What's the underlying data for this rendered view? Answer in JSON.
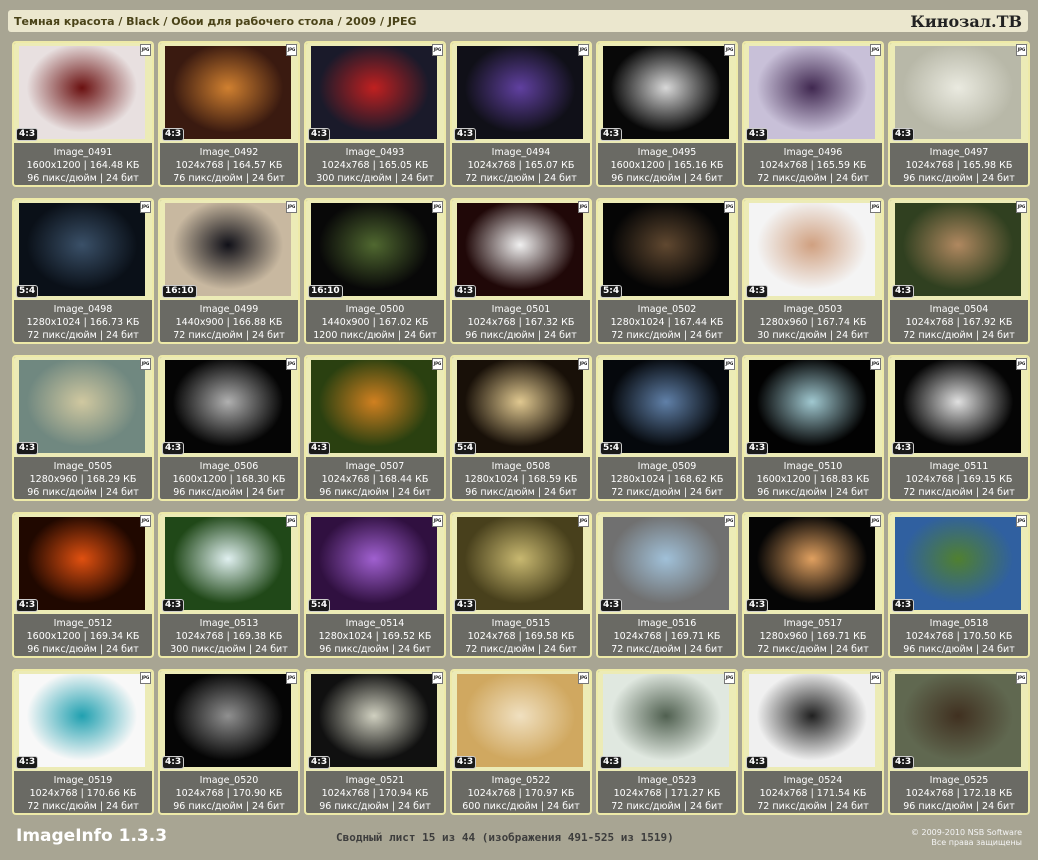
{
  "header": {
    "breadcrumb": "Темная красота / Black / Обои для рабочего стола / 2009 / JPEG",
    "brand": "Кинозал.ТВ"
  },
  "icon": "jpg-file-icon",
  "images": [
    {
      "name": "Image_0491",
      "ratio": "4:3",
      "dims": "1600x1200 | 164.48 КБ",
      "meta": "96 пикс/дюйм | 24 бит",
      "bg": "#e8e0e0",
      "accent": "#6a1010"
    },
    {
      "name": "Image_0492",
      "ratio": "4:3",
      "dims": "1024x768 | 164.57 КБ",
      "meta": "76 пикс/дюйм | 24 бит",
      "bg": "#3a1a10",
      "accent": "#d08030"
    },
    {
      "name": "Image_0493",
      "ratio": "4:3",
      "dims": "1024x768 | 165.05 КБ",
      "meta": "300 пикс/дюйм | 24 бит",
      "bg": "#1a1a2a",
      "accent": "#c02020"
    },
    {
      "name": "Image_0494",
      "ratio": "4:3",
      "dims": "1024x768 | 165.07 КБ",
      "meta": "72 пикс/дюйм | 24 бит",
      "bg": "#101018",
      "accent": "#6040a0"
    },
    {
      "name": "Image_0495",
      "ratio": "4:3",
      "dims": "1600x1200 | 165.16 КБ",
      "meta": "96 пикс/дюйм | 24 бит",
      "bg": "#080808",
      "accent": "#d8d8d8"
    },
    {
      "name": "Image_0496",
      "ratio": "4:3",
      "dims": "1024x768 | 165.59 КБ",
      "meta": "72 пикс/дюйм | 24 бит",
      "bg": "#c8c0d8",
      "accent": "#402850"
    },
    {
      "name": "Image_0497",
      "ratio": "4:3",
      "dims": "1024x768 | 165.98 КБ",
      "meta": "96 пикс/дюйм | 24 бит",
      "bg": "#b8b8a8",
      "accent": "#eaeae0"
    },
    {
      "name": "Image_0498",
      "ratio": "5:4",
      "dims": "1280x1024 | 166.73 КБ",
      "meta": "72 пикс/дюйм | 24 бит",
      "bg": "#0a1018",
      "accent": "#3a5068"
    },
    {
      "name": "Image_0499",
      "ratio": "16:10",
      "dims": "1440x900 | 166.88 КБ",
      "meta": "72 пикс/дюйм | 24 бит",
      "bg": "#c8b8a0",
      "accent": "#101018"
    },
    {
      "name": "Image_0500",
      "ratio": "16:10",
      "dims": "1440x900 | 167.02 КБ",
      "meta": "1200 пикс/дюйм | 24 бит",
      "bg": "#080808",
      "accent": "#506830"
    },
    {
      "name": "Image_0501",
      "ratio": "4:3",
      "dims": "1024x768 | 167.32 КБ",
      "meta": "96 пикс/дюйм | 24 бит",
      "bg": "#200808",
      "accent": "#f0f0f0"
    },
    {
      "name": "Image_0502",
      "ratio": "5:4",
      "dims": "1280x1024 | 167.44 КБ",
      "meta": "72 пикс/дюйм | 24 бит",
      "bg": "#050505",
      "accent": "#604830"
    },
    {
      "name": "Image_0503",
      "ratio": "4:3",
      "dims": "1280x960 | 167.74 КБ",
      "meta": "30 пикс/дюйм | 24 бит",
      "bg": "#f4f4f4",
      "accent": "#d0a080"
    },
    {
      "name": "Image_0504",
      "ratio": "4:3",
      "dims": "1024x768 | 167.92 КБ",
      "meta": "72 пикс/дюйм | 24 бит",
      "bg": "#304020",
      "accent": "#b08860"
    },
    {
      "name": "Image_0505",
      "ratio": "4:3",
      "dims": "1280x960 | 168.29 КБ",
      "meta": "96 пикс/дюйм | 24 бит",
      "bg": "#708880",
      "accent": "#d0c8a0"
    },
    {
      "name": "Image_0506",
      "ratio": "4:3",
      "dims": "1600x1200 | 168.30 КБ",
      "meta": "96 пикс/дюйм | 24 бит",
      "bg": "#050505",
      "accent": "#b0b0b0"
    },
    {
      "name": "Image_0507",
      "ratio": "4:3",
      "dims": "1024x768 | 168.44 КБ",
      "meta": "96 пикс/дюйм | 24 бит",
      "bg": "#2a4010",
      "accent": "#d08020"
    },
    {
      "name": "Image_0508",
      "ratio": "5:4",
      "dims": "1280x1024 | 168.59 КБ",
      "meta": "96 пикс/дюйм | 24 бит",
      "bg": "#181008",
      "accent": "#e0c890"
    },
    {
      "name": "Image_0509",
      "ratio": "5:4",
      "dims": "1280x1024 | 168.62 КБ",
      "meta": "72 пикс/дюйм | 24 бит",
      "bg": "#05080c",
      "accent": "#6080a8"
    },
    {
      "name": "Image_0510",
      "ratio": "4:3",
      "dims": "1600x1200 | 168.83 КБ",
      "meta": "96 пикс/дюйм | 24 бит",
      "bg": "#020202",
      "accent": "#a0c8d0"
    },
    {
      "name": "Image_0511",
      "ratio": "4:3",
      "dims": "1024x768 | 169.15 КБ",
      "meta": "72 пикс/дюйм | 24 бит",
      "bg": "#050505",
      "accent": "#e0e0e0"
    },
    {
      "name": "Image_0512",
      "ratio": "4:3",
      "dims": "1600x1200 | 169.34 КБ",
      "meta": "96 пикс/дюйм | 24 бит",
      "bg": "#200800",
      "accent": "#e05010"
    },
    {
      "name": "Image_0513",
      "ratio": "4:3",
      "dims": "1024x768 | 169.38 КБ",
      "meta": "300 пикс/дюйм | 24 бит",
      "bg": "#204818",
      "accent": "#e0f0f0"
    },
    {
      "name": "Image_0514",
      "ratio": "5:4",
      "dims": "1280x1024 | 169.52 КБ",
      "meta": "96 пикс/дюйм | 24 бит",
      "bg": "#301040",
      "accent": "#a060d0"
    },
    {
      "name": "Image_0515",
      "ratio": "4:3",
      "dims": "1024x768 | 169.58 КБ",
      "meta": "72 пикс/дюйм | 24 бит",
      "bg": "#48401c",
      "accent": "#c8b870"
    },
    {
      "name": "Image_0516",
      "ratio": "4:3",
      "dims": "1024x768 | 169.71 КБ",
      "meta": "72 пикс/дюйм | 24 бит",
      "bg": "#707070",
      "accent": "#a0c0d8"
    },
    {
      "name": "Image_0517",
      "ratio": "4:3",
      "dims": "1280x960 | 169.71 КБ",
      "meta": "72 пикс/дюйм | 24 бит",
      "bg": "#050505",
      "accent": "#e0a060"
    },
    {
      "name": "Image_0518",
      "ratio": "4:3",
      "dims": "1024x768 | 170.50 КБ",
      "meta": "96 пикс/дюйм | 24 бит",
      "bg": "#3060a0",
      "accent": "#508030"
    },
    {
      "name": "Image_0519",
      "ratio": "4:3",
      "dims": "1024x768 | 170.66 КБ",
      "meta": "72 пикс/дюйм | 24 бит",
      "bg": "#f8f8f8",
      "accent": "#20a0b0"
    },
    {
      "name": "Image_0520",
      "ratio": "4:3",
      "dims": "1024x768 | 170.90 КБ",
      "meta": "96 пикс/дюйм | 24 бит",
      "bg": "#050505",
      "accent": "#909090"
    },
    {
      "name": "Image_0521",
      "ratio": "4:3",
      "dims": "1024x768 | 170.94 КБ",
      "meta": "96 пикс/дюйм | 24 бит",
      "bg": "#101010",
      "accent": "#d0d0c0"
    },
    {
      "name": "Image_0522",
      "ratio": "4:3",
      "dims": "1024x768 | 170.97 КБ",
      "meta": "600 пикс/дюйм | 24 бит",
      "bg": "#d0a860",
      "accent": "#f0e0c0"
    },
    {
      "name": "Image_0523",
      "ratio": "4:3",
      "dims": "1024x768 | 171.27 КБ",
      "meta": "72 пикс/дюйм | 24 бит",
      "bg": "#e0e8e0",
      "accent": "#506050"
    },
    {
      "name": "Image_0524",
      "ratio": "4:3",
      "dims": "1024x768 | 171.54 КБ",
      "meta": "72 пикс/дюйм | 24 бит",
      "bg": "#f0f0f0",
      "accent": "#202020"
    },
    {
      "name": "Image_0525",
      "ratio": "4:3",
      "dims": "1024x768 | 172.18 КБ",
      "meta": "96 пикс/дюйм | 24 бит",
      "bg": "#606850",
      "accent": "#403020"
    }
  ],
  "footer": {
    "app_title": "ImageInfo 1.3.3",
    "summary": "Сводный лист 15 из 44 (изображения 491-525 из 1519)",
    "copyright_line1": "© 2009-2010 NSB Software",
    "copyright_line2": "Все права защищены"
  }
}
